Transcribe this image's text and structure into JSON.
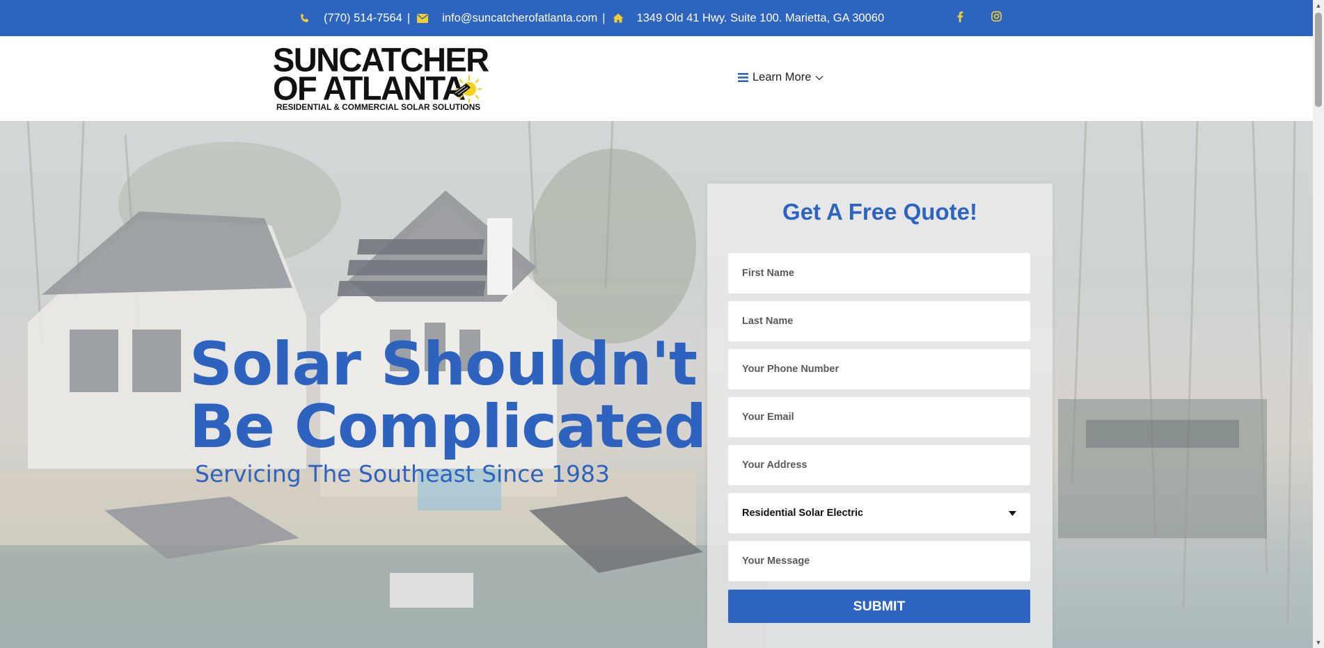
{
  "topbar": {
    "phone": "(770) 514-7564",
    "email": "info@suncatcherofatlanta.com",
    "address": "1349 Old 41 Hwy. Suite 100. Marietta, GA 30060",
    "separator": "|",
    "icons": [
      "phone-icon",
      "envelope-icon",
      "home-icon",
      "facebook-icon",
      "instagram-icon"
    ],
    "accent_color": "#f2cf2e",
    "background_color": "#2c64c0"
  },
  "logo": {
    "line1": "SUNCATCHER",
    "line2": "OF ATLANTA",
    "tagline": "RESIDENTIAL & COMMERCIAL SOLAR SOLUTIONS"
  },
  "nav": {
    "menu_label": "Learn More",
    "icons": [
      "hamburger-icon",
      "chevron-down-icon"
    ]
  },
  "hero": {
    "headline_line1": "Solar Shouldn't",
    "headline_line2": "Be Complicated",
    "subheadline": "Servicing The Southeast Since 1983",
    "text_color": "#2d63bf"
  },
  "quote_form": {
    "title": "Get A Free Quote!",
    "first_name_placeholder": "First Name",
    "last_name_placeholder": "Last Name",
    "phone_placeholder": "Your Phone Number",
    "email_placeholder": "Your Email",
    "address_placeholder": "Your Address",
    "service_selected": "Residential Solar Electric",
    "message_placeholder": "Your Message",
    "submit_label": "SUBMIT"
  }
}
